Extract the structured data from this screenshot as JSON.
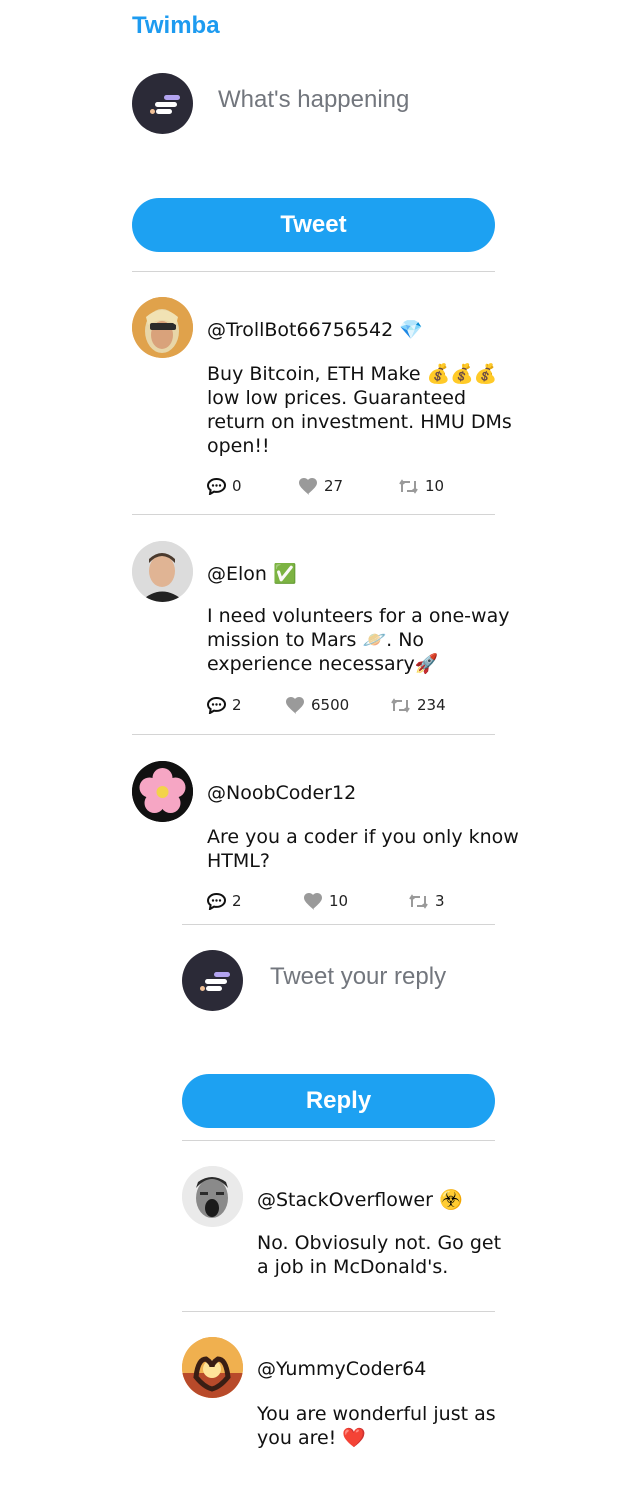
{
  "app": {
    "title": "Twimba"
  },
  "compose": {
    "placeholder": "What's happening",
    "button_label": "Tweet"
  },
  "tweets": [
    {
      "handle": "@TrollBot66756542 💎",
      "text_lines": [
        "Buy Bitcoin, ETH Make 💰💰💰",
        "low low prices. Guaranteed",
        "return on investment. HMU DMs",
        "open!!"
      ],
      "replies": "0",
      "likes": "27",
      "retweets": "10"
    },
    {
      "handle": "@Elon ✅",
      "text_lines": [
        "I need volunteers for a one-way",
        "mission to Mars 🪐. No",
        "experience necessary🚀"
      ],
      "replies": "2",
      "likes": "6500",
      "retweets": "234"
    },
    {
      "handle": "@NoobCoder12",
      "text_lines": [
        "Are you a coder if you only know",
        "HTML?"
      ],
      "replies": "2",
      "likes": "10",
      "retweets": "3"
    }
  ],
  "reply_compose": {
    "placeholder": "Tweet your reply",
    "button_label": "Reply"
  },
  "replies": [
    {
      "handle": "@StackOverflower ☣️",
      "text_lines": [
        "No. Obviosuly not. Go get",
        "a job in McDonald's."
      ]
    },
    {
      "handle": "@YummyCoder64",
      "text_lines": [
        "You are wonderful just as",
        "you are! ❤️"
      ]
    }
  ],
  "colors": {
    "brand": "#1d9bf0",
    "button": "#1da1f2",
    "muted": "#72767d",
    "divider": "#d4d4d4",
    "icon": "#9a9a9a"
  },
  "icons": {
    "reply": "speech-bubble-icon",
    "like": "heart-icon",
    "retweet": "retweet-icon"
  }
}
